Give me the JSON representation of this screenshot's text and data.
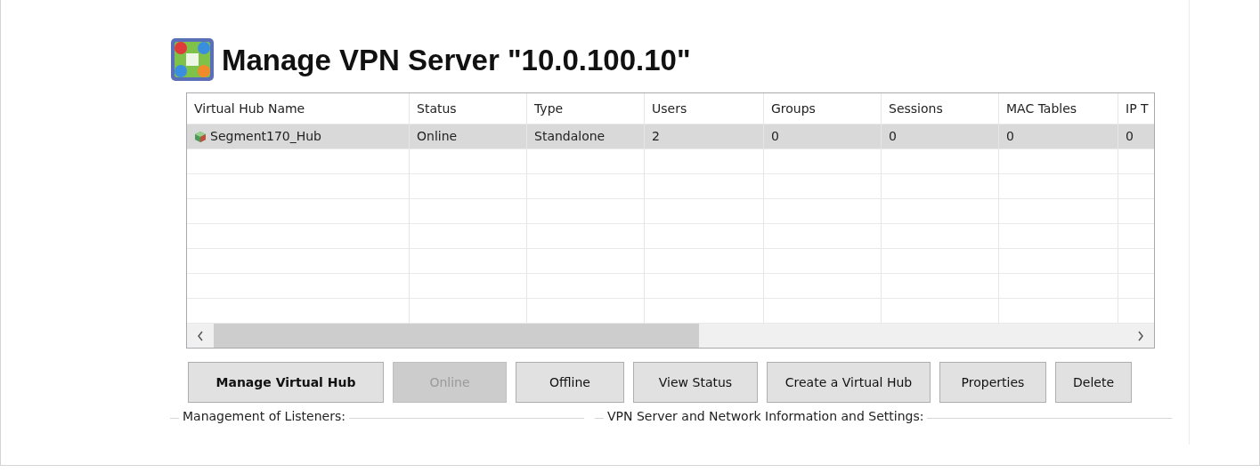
{
  "window": {
    "title": "Manage VPN Server \"10.0.100.10\""
  },
  "table": {
    "columns": [
      "Virtual Hub Name",
      "Status",
      "Type",
      "Users",
      "Groups",
      "Sessions",
      "MAC Tables",
      "IP T"
    ],
    "rows": [
      {
        "selected": true,
        "cells": [
          "Segment170_Hub",
          "Online",
          "Standalone",
          "2",
          "0",
          "0",
          "0",
          "0"
        ]
      }
    ]
  },
  "buttons": [
    {
      "label": "Manage Virtual Hub",
      "kind": "primary",
      "disabled": false
    },
    {
      "label": "Online",
      "kind": "normal",
      "disabled": true
    },
    {
      "label": "Offline",
      "kind": "normal",
      "disabled": false
    },
    {
      "label": "View Status",
      "kind": "normal",
      "disabled": false
    },
    {
      "label": "Create a Virtual Hub",
      "kind": "normal",
      "disabled": false
    },
    {
      "label": "Properties",
      "kind": "normal",
      "disabled": false
    },
    {
      "label": "Delete",
      "kind": "normal",
      "disabled": false
    }
  ],
  "groups": [
    {
      "label": "Management of Listeners:"
    },
    {
      "label": "VPN Server and Network Information and Settings:"
    }
  ]
}
